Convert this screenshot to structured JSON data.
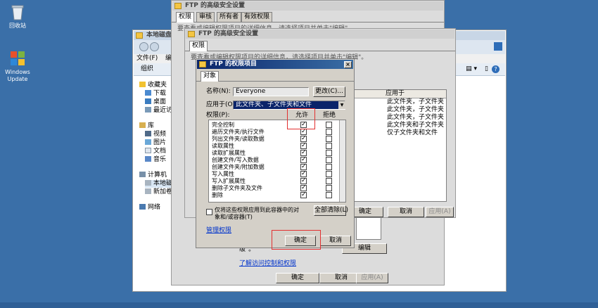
{
  "desktop": {
    "icons": [
      {
        "label": "回收站"
      },
      {
        "label": "Windows Update"
      }
    ]
  },
  "explorer": {
    "title": "本地磁盘",
    "menu": [
      "文件(F)",
      "编"
    ],
    "organize_label": "组织",
    "sidebar": [
      {
        "label": "收藏夹",
        "icon": "star-icon"
      },
      {
        "label": "下载",
        "icon": "download-icon"
      },
      {
        "label": "桌面",
        "icon": "desktop-icon"
      },
      {
        "label": "最近访",
        "icon": "recent-icon"
      },
      {
        "label": "库",
        "icon": "library-icon"
      },
      {
        "label": "视频",
        "icon": "video-icon"
      },
      {
        "label": "图片",
        "icon": "picture-icon"
      },
      {
        "label": "文档",
        "icon": "document-icon"
      },
      {
        "label": "音乐",
        "icon": "music-icon"
      },
      {
        "label": "计算机",
        "icon": "computer-icon"
      },
      {
        "label": "本地磁",
        "icon": "drive-icon"
      },
      {
        "label": "新加卷",
        "icon": "drive-icon"
      },
      {
        "label": "网络",
        "icon": "network-icon"
      }
    ]
  },
  "adv_back": {
    "title": "FTP 的高级安全设置",
    "tabs": [
      "权限",
      "审核",
      "所有者",
      "有效权限"
    ],
    "note_text": "要查看或编辑权限项目的详细信息，请选择项目并单击\"编辑\"。",
    "inherit_suffix": "级\"。",
    "link_label": "了解访问控制和权限",
    "buttons": {
      "ok": "确定",
      "cancel": "取消",
      "apply": "应用(A)"
    }
  },
  "adv_front": {
    "title": "FTP 的高级安全设置",
    "tab": "权限",
    "desc": "要查看或编辑权限项目的详细信息，请选择项目并单击\"编辑\"。",
    "col_apply": "应用于",
    "apply_rows": [
      "此文件夹，子文件夹",
      "此文件夹，子文件夹",
      "此文件夹，子文件夹",
      "此文件夹和子文件夹",
      "仅子文件夹和文件"
    ],
    "buttons": {
      "ok": "确定",
      "cancel": "取消",
      "apply": "应用(A)"
    }
  },
  "perm_dialog": {
    "title": "FTP 的权限项目",
    "tab": "对象",
    "name_label": "名称(N):",
    "name_value": "Everyone",
    "change_button": "更改(C)...",
    "apply_to_label": "应用于(O):",
    "apply_to_value": "此文件夹、子文件夹和文件",
    "permissions_label": "权限(P):",
    "allow_header": "允许",
    "deny_header": "拒绝",
    "permissions": [
      {
        "name": "完全控制",
        "allow": true,
        "deny": false
      },
      {
        "name": "遍历文件夹/执行文件",
        "allow": true,
        "deny": false
      },
      {
        "name": "列出文件夹/读取数据",
        "allow": true,
        "deny": false
      },
      {
        "name": "读取属性",
        "allow": true,
        "deny": false
      },
      {
        "name": "读取扩展属性",
        "allow": true,
        "deny": false
      },
      {
        "name": "创建文件/写入数据",
        "allow": true,
        "deny": false
      },
      {
        "name": "创建文件夹/附加数据",
        "allow": true,
        "deny": false
      },
      {
        "name": "写入属性",
        "allow": true,
        "deny": false
      },
      {
        "name": "写入扩展属性",
        "allow": true,
        "deny": false
      },
      {
        "name": "删除子文件夹及文件",
        "allow": true,
        "deny": false
      },
      {
        "name": "删除",
        "allow": true,
        "deny": false
      }
    ],
    "only_apply_label": "仅将这些权限应用到此容器中的对象和/或容器(T)",
    "clear_all_button": "全部清除(L)",
    "manage_link": "管理权限",
    "ok_button": "确定",
    "cancel_button": "取消"
  },
  "colors": {
    "desktop": "#3A6FA8",
    "highlight": "#E23030",
    "link": "#0033CC"
  }
}
